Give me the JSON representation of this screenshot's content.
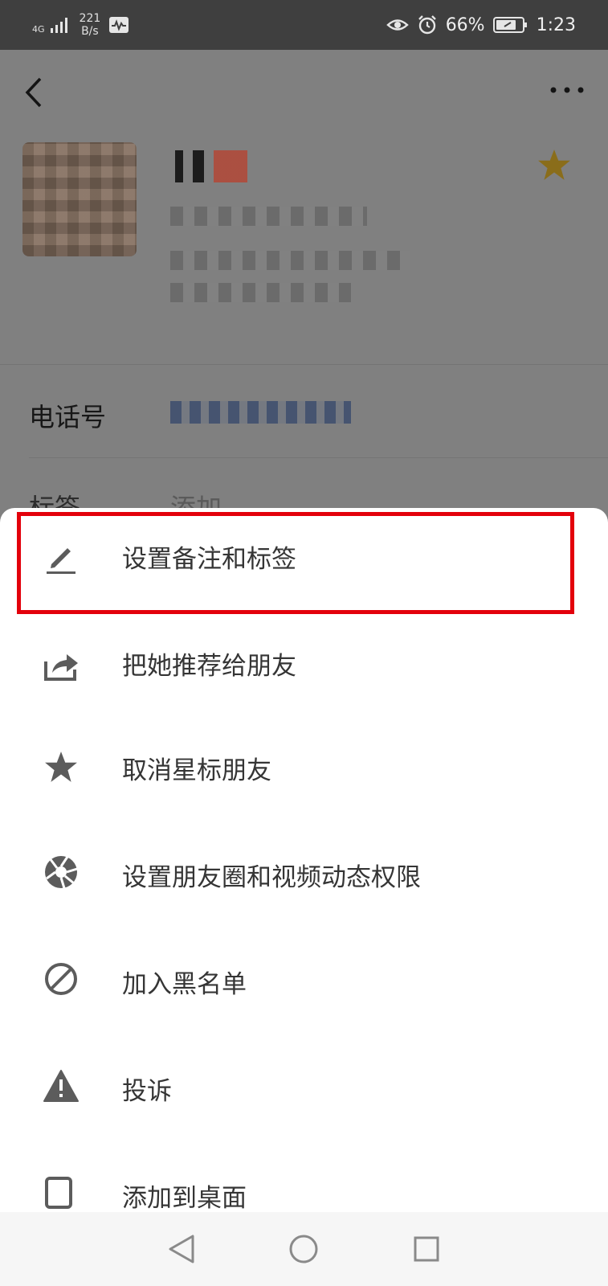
{
  "status_bar": {
    "network": "4G",
    "data_rate_value": "221",
    "data_rate_unit": "B/s",
    "battery_percent": "66%",
    "time": "1:23"
  },
  "profile": {
    "phone_label": "电话号",
    "tag_label": "标签",
    "tag_value": "添加",
    "starred": true,
    "star_color": "#d9a400"
  },
  "menu": {
    "highlight_color": "#e3000b",
    "items": [
      {
        "label": "设置备注和标签",
        "icon": "pencil-icon"
      },
      {
        "label": "把她推荐给朋友",
        "icon": "share-icon"
      },
      {
        "label": "取消星标朋友",
        "icon": "star-icon"
      },
      {
        "label": "设置朋友圈和视频动态权限",
        "icon": "aperture-icon"
      },
      {
        "label": "加入黑名单",
        "icon": "block-icon"
      },
      {
        "label": "投诉",
        "icon": "warning-icon"
      },
      {
        "label": "添加到桌面",
        "icon": "add-to-desktop-icon"
      }
    ]
  },
  "nav_bar": {
    "buttons": [
      "back-triangle-icon",
      "home-circle-icon",
      "recents-square-icon"
    ]
  }
}
